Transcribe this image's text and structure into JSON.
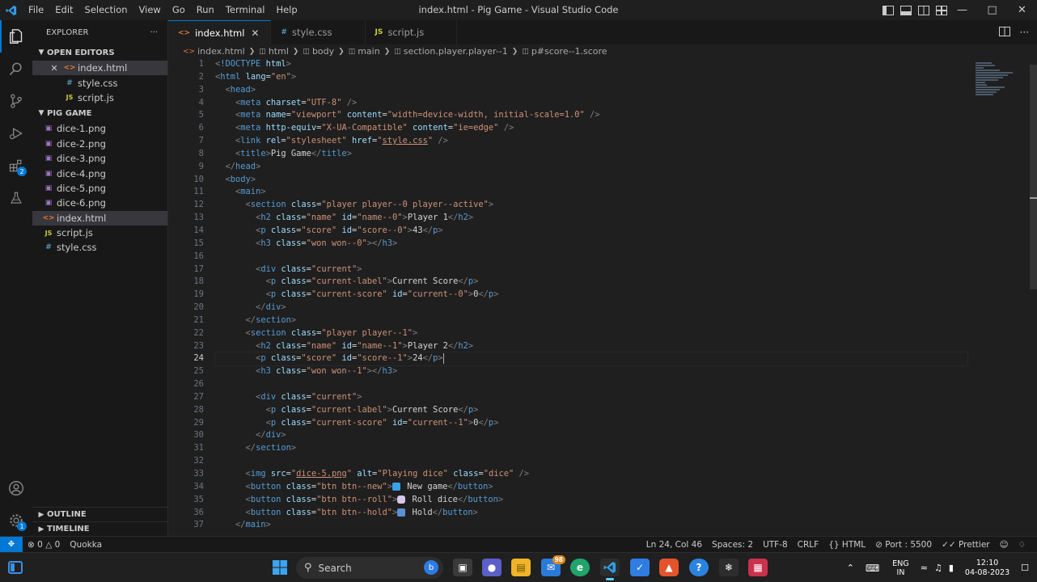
{
  "titlebar": {
    "menus": [
      "File",
      "Edit",
      "Selection",
      "View",
      "Go",
      "Run",
      "Terminal",
      "Help"
    ],
    "title": "index.html - Pig Game - Visual Studio Code"
  },
  "sidebar": {
    "header": "EXPLORER",
    "more": "···",
    "open_editors_label": "OPEN EDITORS",
    "open_editors": [
      "index.html",
      "style.css",
      "script.js"
    ],
    "folder_label": "PIG GAME",
    "files": [
      "dice-1.png",
      "dice-2.png",
      "dice-3.png",
      "dice-4.png",
      "dice-5.png",
      "dice-6.png",
      "index.html",
      "script.js",
      "style.css"
    ],
    "outline_label": "OUTLINE",
    "timeline_label": "TIMELINE"
  },
  "tabs": [
    {
      "label": "index.html",
      "icon": "<>"
    },
    {
      "label": "style.css",
      "icon": "#"
    },
    {
      "label": "script.js",
      "icon": "JS"
    }
  ],
  "breadcrumb": [
    "index.html",
    "html",
    "body",
    "main",
    "section.player.player--1",
    "p#score--1.score"
  ],
  "editor": {
    "line_numbers": [
      "1",
      "2",
      "3",
      "4",
      "5",
      "6",
      "7",
      "8",
      "9",
      "10",
      "11",
      "12",
      "13",
      "14",
      "15",
      "16",
      "17",
      "18",
      "19",
      "20",
      "21",
      "22",
      "23",
      "24",
      "25",
      "26",
      "27",
      "28",
      "29",
      "30",
      "31",
      "32",
      "33",
      "34",
      "35",
      "36",
      "37"
    ],
    "t": {
      "doctype": "!DOCTYPE",
      "html": "html",
      "head": "head",
      "meta": "meta",
      "link": "link",
      "title": "title",
      "body": "body",
      "main": "main",
      "section": "section",
      "h2": "h2",
      "p": "p",
      "h3": "h3",
      "div": "div",
      "img": "img",
      "button": "button"
    },
    "a": {
      "lang": "lang",
      "charset": "charset",
      "name": "name",
      "content": "content",
      "http_equiv": "http-equiv",
      "rel": "rel",
      "href": "href",
      "class": "class",
      "id": "id",
      "src": "src",
      "alt": "alt"
    },
    "v": {
      "en": "\"en\"",
      "utf8": "\"UTF-8\"",
      "viewport": "\"viewport\"",
      "viewport_content": "\"width=device-width, initial-scale=1.0\"",
      "xua": "\"X-UA-Compatible\"",
      "ie_edge": "\"ie=edge\"",
      "stylesheet": "\"stylesheet\"",
      "style_css_q": "\"",
      "style_css": "style.css",
      "player0": "\"player player--0 player--active\"",
      "name_cls": "\"name\"",
      "name0": "\"name--0\"",
      "score_cls": "\"score\"",
      "score0": "\"score--0\"",
      "won0": "\"won won--0\"",
      "current_cls": "\"current\"",
      "current_label": "\"current-label\"",
      "current_score": "\"current-score\"",
      "current0": "\"current--0\"",
      "player1": "\"player player--1\"",
      "name1": "\"name--1\"",
      "score1": "\"score--1\"",
      "won1": "\"won won--1\"",
      "current1": "\"current--1\"",
      "dice5": "dice-5.png",
      "playing_dice": "\"Playing dice\"",
      "dice_cls": "\"dice\"",
      "btn_new": "\"btn btn--new\"",
      "btn_roll": "\"btn btn--roll\"",
      "btn_hold": "\"btn btn--hold\""
    },
    "x": {
      "title": "Pig Game",
      "player1": "Player 1",
      "score0": "43",
      "current_score": "Current Score",
      "zero": "0",
      "player2": "Player 2",
      "score1": "24",
      "new_game": "New game",
      "roll_dice": "Roll dice",
      "hold": "Hold"
    }
  },
  "statusbar": {
    "errors": "0",
    "warnings": "0",
    "quokka": "Quokka",
    "position": "Ln 24, Col 46",
    "spaces": "Spaces: 2",
    "encoding": "UTF-8",
    "eol": "CRLF",
    "language": "HTML",
    "port": "Port : 5500",
    "prettier": "Prettier"
  },
  "taskbar": {
    "search": "Search",
    "mail_badge": "98",
    "lang_line1": "ENG",
    "lang_line2": "IN",
    "time": "12:10",
    "date": "04-08-2023"
  },
  "colors": {
    "accent": "#0078d4",
    "tag": "#569cd6",
    "attr": "#9cdcfe",
    "string": "#ce9178",
    "bracket": "#808080"
  }
}
